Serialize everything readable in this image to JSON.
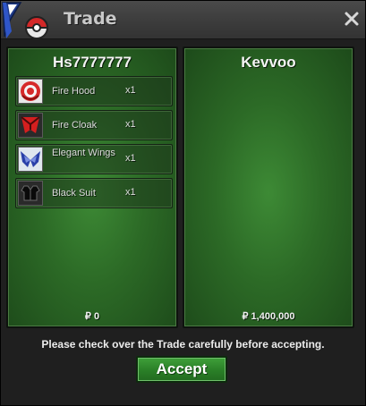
{
  "window": {
    "title": "Trade",
    "logo_icon": "game-logo-icon",
    "close_icon": "close-icon"
  },
  "left_panel": {
    "player_name": "Hs7777777",
    "items": [
      {
        "name": "Fire Hood",
        "qty": "x1",
        "icon": "fire-hood-icon"
      },
      {
        "name": "Fire Cloak",
        "qty": "x1",
        "icon": "fire-cloak-icon"
      },
      {
        "name": "Elegant Wings",
        "qty": "x1",
        "icon": "elegant-wings-icon"
      },
      {
        "name": "Black Suit",
        "qty": "x1",
        "icon": "black-suit-icon"
      }
    ],
    "money": "₽ 0"
  },
  "right_panel": {
    "player_name": "Kevvoo",
    "items": [],
    "money": "₽ 1,400,000"
  },
  "notice": "Please check over the Trade carefully before accepting.",
  "accept_label": "Accept",
  "colors": {
    "panel_green": "#2c6a26",
    "accept_green": "#2a7f27",
    "titlebar": "#3c3c3c"
  }
}
